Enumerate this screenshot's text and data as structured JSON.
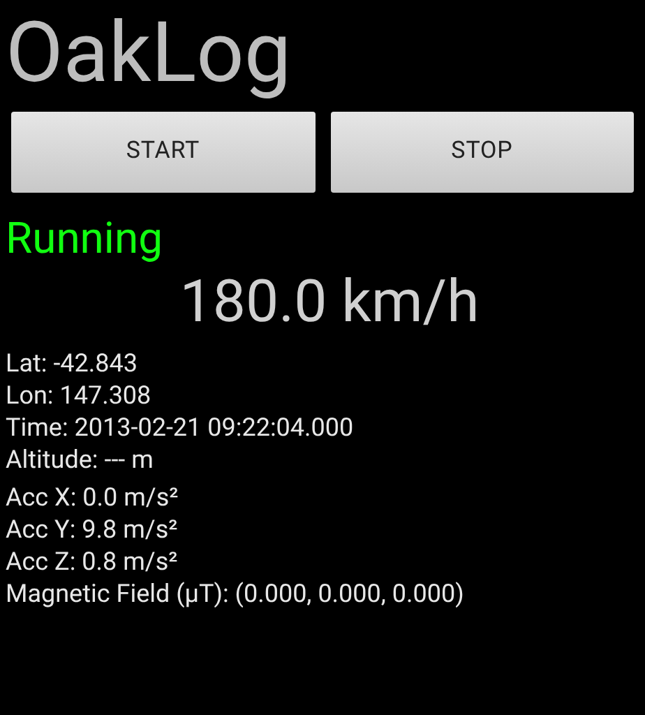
{
  "app_title": "OakLog",
  "buttons": [
    {
      "label": "START"
    },
    {
      "label": "STOP"
    }
  ],
  "status": "Running",
  "speed": "180.0 km/h",
  "location": [
    "Lat: -42.843",
    "Lon: 147.308",
    "Time: 2013-02-21 09:22:04.000",
    "Altitude: --- m"
  ],
  "sensors": [
    "Acc X: 0.0 m/s²",
    "Acc Y: 9.8 m/s²",
    "Acc Z: 0.8 m/s²",
    "Magnetic Field (µT): (0.000, 0.000, 0.000)"
  ]
}
